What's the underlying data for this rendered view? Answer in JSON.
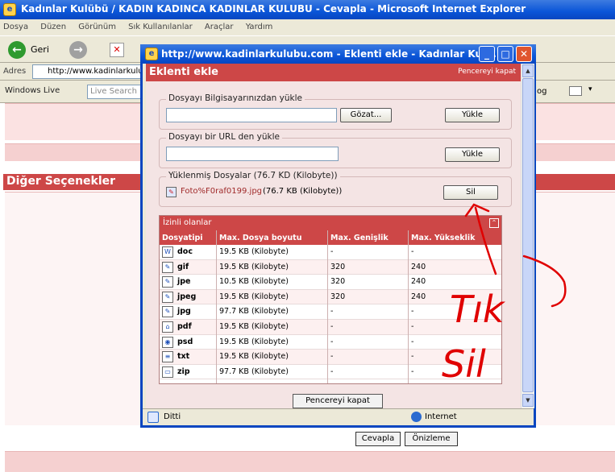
{
  "window": {
    "title": "Kadınlar Kulübü / KADIN KADINCA KADINLAR KULUBU - Cevapla - Microsoft Internet Explorer"
  },
  "menu": [
    "Dosya",
    "Düzen",
    "Görünüm",
    "Sık Kullanılanlar",
    "Araçlar",
    "Yardım"
  ],
  "toolbar": {
    "back_label": "Geri"
  },
  "address": {
    "label": "Adres",
    "url": "http://www.kadinlarkulu"
  },
  "live": {
    "brand": "Windows Live",
    "search_placeholder": "Live Search",
    "right_text": "og"
  },
  "page": {
    "section_title": "Diğer Seçenekler",
    "reply_button": "Cevapla",
    "preview_button": "Önizleme"
  },
  "popup": {
    "title": "http://www.kadinlarkulubu.com - Eklenti ekle - Kadınlar Kul...",
    "header": "Eklenti ekle",
    "close_link": "Pencereyi kapat",
    "upload_local": {
      "legend": "Dosyayı Bilgisayarınızdan yükle",
      "browse": "Gözat...",
      "upload": "Yükle"
    },
    "upload_url": {
      "legend": "Dosyayı bir URL den yükle",
      "upload": "Yükle"
    },
    "uploaded": {
      "legend": "Yüklenmiş Dosyalar (76.7 KD (Kilobyte))",
      "file_name": "Foto%F0raf0199.jpg",
      "file_size": "(76.7 KB (Kilobyte))",
      "delete": "Sil"
    },
    "allowed": {
      "title": "İzinli olanlar",
      "columns": [
        "Dosyatipi",
        "Max. Dosya boyutu",
        "Max. Genişlik",
        "Max. Yükseklik"
      ],
      "rows": [
        {
          "icon": "word-doc-icon",
          "type": "doc",
          "size": "19.5 KB (Kilobyte)",
          "width": "-",
          "height": "-"
        },
        {
          "icon": "image-icon",
          "type": "gif",
          "size": "19.5 KB (Kilobyte)",
          "width": "320",
          "height": "240"
        },
        {
          "icon": "image-icon",
          "type": "jpe",
          "size": "10.5 KB (Kilobyte)",
          "width": "320",
          "height": "240"
        },
        {
          "icon": "image-icon",
          "type": "jpeg",
          "size": "19.5 KB (Kilobyte)",
          "width": "320",
          "height": "240"
        },
        {
          "icon": "image-icon",
          "type": "jpg",
          "size": "97.7 KB (Kilobyte)",
          "width": "-",
          "height": "-"
        },
        {
          "icon": "pdf-icon",
          "type": "pdf",
          "size": "19.5 KB (Kilobyte)",
          "width": "-",
          "height": "-"
        },
        {
          "icon": "psd-icon",
          "type": "psd",
          "size": "19.5 KB (Kilobyte)",
          "width": "-",
          "height": "-"
        },
        {
          "icon": "text-file-icon",
          "type": "txt",
          "size": "19.5 KB (Kilobyte)",
          "width": "-",
          "height": "-"
        },
        {
          "icon": "zip-folder-icon",
          "type": "zip",
          "size": "97.7 KB (Kilobyte)",
          "width": "-",
          "height": "-"
        }
      ]
    },
    "bottom_close": "Pencereyi kapat",
    "status_left": "Ditti",
    "status_zone": "Internet"
  },
  "annotation": {
    "line1": "Tık",
    "line2": "Sil",
    "color": "#e00000"
  }
}
